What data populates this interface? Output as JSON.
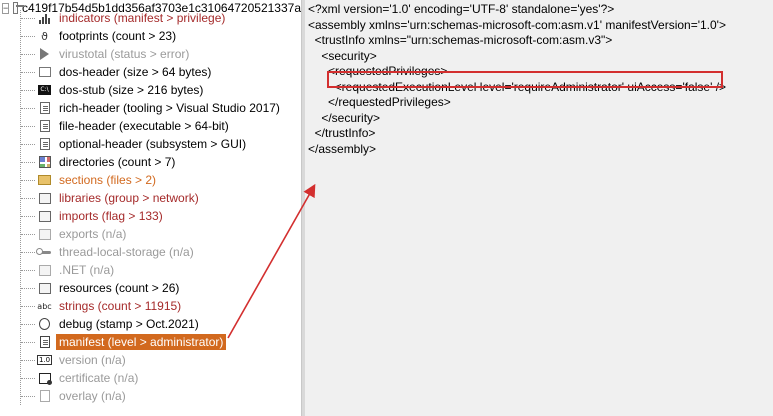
{
  "tree": {
    "root_label": "c419f17b54d5b1dd356af3703e1c31064720521337a",
    "expander_symbol": "−",
    "items": [
      {
        "label": "indicators (manifest > privilege)",
        "color": "red",
        "icon": "bar-chart-icon"
      },
      {
        "label": "footprints (count > 23)",
        "color": "black",
        "icon": "fingerprint-icon"
      },
      {
        "label": "virustotal (status > error)",
        "color": "gray",
        "icon": "virustotal-icon"
      },
      {
        "label": "dos-header (size > 64 bytes)",
        "color": "black",
        "icon": "window-icon"
      },
      {
        "label": "dos-stub (size > 216 bytes)",
        "color": "black",
        "icon": "console-icon",
        "icon_text": "C:\\"
      },
      {
        "label": "rich-header (tooling > Visual Studio 2017)",
        "color": "black",
        "icon": "document-icon"
      },
      {
        "label": "file-header (executable > 64-bit)",
        "color": "black",
        "icon": "document-icon"
      },
      {
        "label": "optional-header (subsystem > GUI)",
        "color": "black",
        "icon": "document-icon"
      },
      {
        "label": "directories (count > 7)",
        "color": "black",
        "icon": "directories-icon"
      },
      {
        "label": "sections (files > 2)",
        "color": "orange",
        "icon": "folder-icon"
      },
      {
        "label": "libraries (group > network)",
        "color": "red",
        "icon": "library-icon"
      },
      {
        "label": "imports (flag > 133)",
        "color": "red",
        "icon": "imports-icon"
      },
      {
        "label": "exports (n/a)",
        "color": "gray",
        "icon": "exports-icon"
      },
      {
        "label": "thread-local-storage (n/a)",
        "color": "gray",
        "icon": "key-icon"
      },
      {
        "label": ".NET (n/a)",
        "color": "gray",
        "icon": "dotnet-icon"
      },
      {
        "label": "resources (count > 26)",
        "color": "black",
        "icon": "resources-icon"
      },
      {
        "label": "strings (count > 11915)",
        "color": "red",
        "icon": "strings-icon",
        "icon_text": "abc"
      },
      {
        "label": "debug (stamp > Oct.2021)",
        "color": "black",
        "icon": "bug-icon"
      },
      {
        "label": "manifest (level > administrator)",
        "color": "selected",
        "icon": "manifest-icon"
      },
      {
        "label": "version (n/a)",
        "color": "gray",
        "icon": "version-icon",
        "icon_text": "1.0"
      },
      {
        "label": "certificate (n/a)",
        "color": "gray",
        "icon": "certificate-icon"
      },
      {
        "label": "overlay (n/a)",
        "color": "gray",
        "icon": "overlay-icon"
      }
    ]
  },
  "xml": {
    "lines": [
      "<?xml version='1.0' encoding='UTF-8' standalone='yes'?>",
      "<assembly xmlns='urn:schemas-microsoft-com:asm.v1' manifestVersion='1.0'>",
      "  <trustInfo xmlns=\"urn:schemas-microsoft-com:asm.v3\">",
      "    <security>",
      "      <requestedPrivileges>",
      "        <requestedExecutionLevel level='requireAdministrator' uiAccess='false' />",
      "      </requestedPrivileges>",
      "    </security>",
      "  </trustInfo>",
      "</assembly>"
    ],
    "highlighted_line_index": 5
  },
  "colors": {
    "red_text": "#a52a2a",
    "gray_text": "#9a9a9a",
    "orange_text": "#d2691e",
    "selection_bg": "#d2691e",
    "annotation_red": "#d32f2f",
    "right_pane_bg": "#f0f0f0"
  }
}
